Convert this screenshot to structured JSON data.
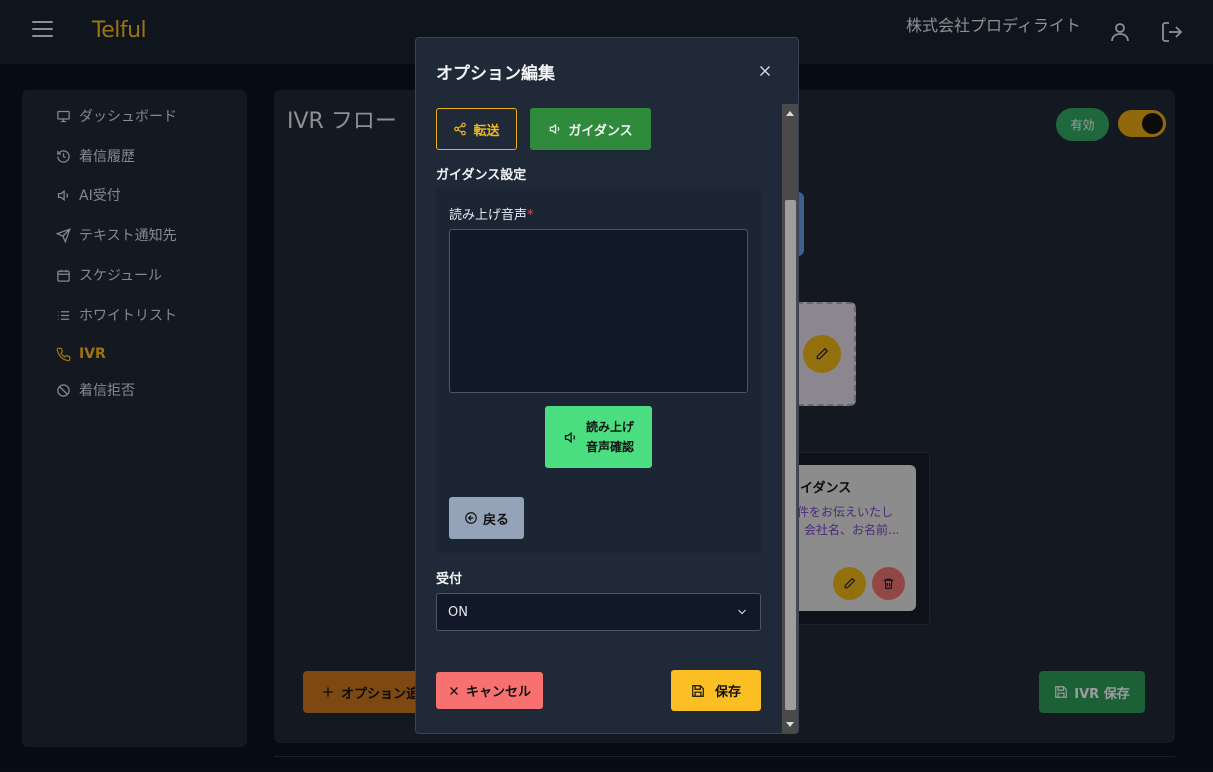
{
  "header": {
    "logo": "Telful",
    "company": "株式会社プロディライト"
  },
  "sidebar": {
    "items": [
      {
        "label": "ダッシュボード",
        "icon": "monitor-icon"
      },
      {
        "label": "着信履歴",
        "icon": "history-icon"
      },
      {
        "label": "AI受付",
        "icon": "speaker-icon"
      },
      {
        "label": "テキスト通知先",
        "icon": "send-icon"
      },
      {
        "label": "スケジュール",
        "icon": "calendar-icon"
      },
      {
        "label": "ホワイトリスト",
        "icon": "list-icon"
      },
      {
        "label": "IVR",
        "icon": "phone-icon",
        "active": true
      },
      {
        "label": "着信拒否",
        "icon": "block-icon"
      }
    ]
  },
  "main": {
    "title": "IVR フロー",
    "status_badge": "有効",
    "toggle_on": true,
    "guidance_card": {
      "title": "イダンス",
      "line1": "件をお伝えいたし",
      "line2": "会社名、お名前..."
    },
    "add_option_label": "オプション追",
    "save_ivr_label": "IVR 保存"
  },
  "modal": {
    "title": "オプション編集",
    "tabs": {
      "transfer": "転送",
      "guidance": "ガイダンス"
    },
    "section_title": "ガイダンス設定",
    "speech_label": "読み上げ音声",
    "required_mark": "*",
    "speech_value": "",
    "preview_line1": "読み上げ",
    "preview_line2": "音声確認",
    "back_label": "戻る",
    "accept_label": "受付",
    "accept_value": "ON",
    "cancel_label": "キャンセル",
    "save_label": "保存"
  },
  "colors": {
    "accent": "#e8a91a",
    "success": "#2f8a3b",
    "danger": "#f87171",
    "warning": "#fbbf24"
  }
}
